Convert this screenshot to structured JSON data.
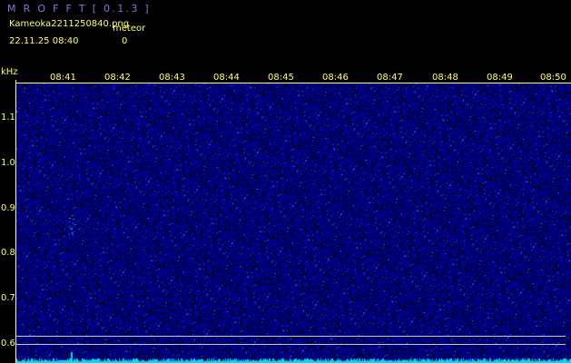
{
  "header": {
    "app_title": "M R O F F T  [ 0.1.3 ]",
    "filename": "Kameoka2211250840.png",
    "meteor_label": "meteor",
    "datetime": "22.11.25 08:40",
    "meteor_count": "0"
  },
  "spectrogram": {
    "freq_unit": "kHz",
    "time_ticks": [
      "08:41",
      "08:42",
      "08:43",
      "08:44",
      "08:45",
      "08:46",
      "08:47",
      "08:48",
      "08:49",
      "08:50"
    ],
    "freq_ticks": [
      "1.1",
      "1.0",
      "0.9",
      "0.8",
      "0.7",
      "0.6"
    ],
    "colors": {
      "background": "#000000",
      "noise": "#0000cc",
      "text": "#ffff66",
      "trace": "#00e5ff"
    }
  }
}
